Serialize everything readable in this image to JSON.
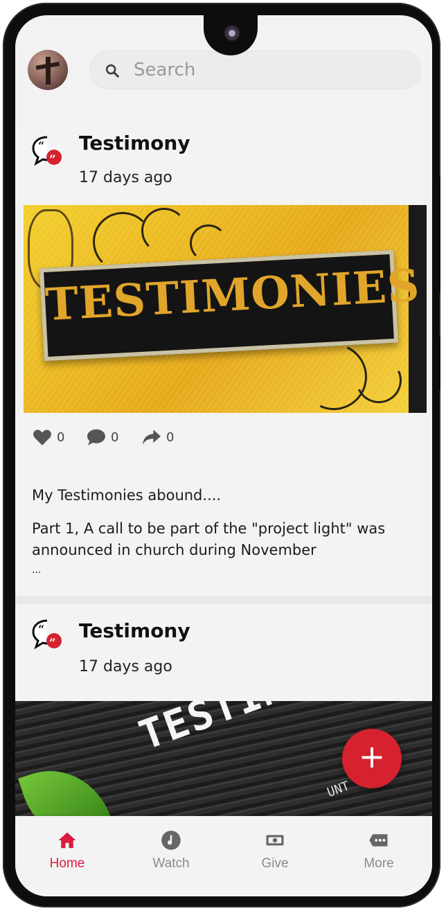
{
  "search": {
    "placeholder": "Search"
  },
  "posts": [
    {
      "title": "Testimony",
      "time": "17 days ago",
      "banner_text": "TESTIMONIES",
      "likes": "0",
      "comments": "0",
      "shares": "0",
      "headline": "My Testimonies abound....",
      "body": "Part 1, A call to be part of the \"project light\" was announced in church during November",
      "more": "..."
    },
    {
      "title": "Testimony",
      "time": "17 days ago",
      "banner_text": "TESTIMONY",
      "banner_sub": "UNT ... OD"
    }
  ],
  "fab": {
    "label": "+"
  },
  "nav": [
    {
      "label": "Home",
      "icon": "home-icon",
      "active": true
    },
    {
      "label": "Watch",
      "icon": "music-disc-icon",
      "active": false
    },
    {
      "label": "Give",
      "icon": "cash-icon",
      "active": false
    },
    {
      "label": "More",
      "icon": "more-icon",
      "active": false
    }
  ],
  "colors": {
    "accent": "#d81b3f",
    "fab": "#d6212f",
    "banner_yellow": "#f3cf2c"
  }
}
